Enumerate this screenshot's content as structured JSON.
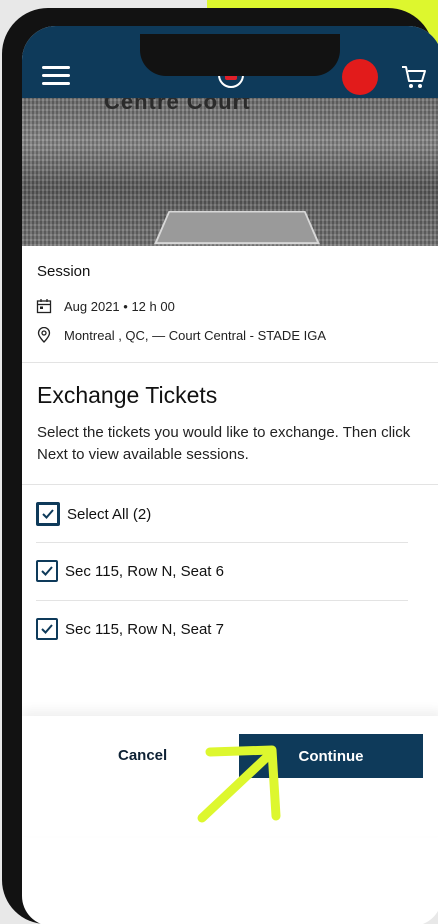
{
  "colors": {
    "accent": "#0e3a5a",
    "highlight": "#ddf72e",
    "avatar": "#e21b1b"
  },
  "header": {
    "menu_icon": "hamburger-menu-icon",
    "logo_icon": "brand-logo-icon",
    "cart_icon": "cart-icon"
  },
  "hero": {
    "sign_text": "Centre Court"
  },
  "session": {
    "title": "Session",
    "date": "Aug 2021 • 12 h 00",
    "location": "Montreal , QC, — Court Central - STADE IGA"
  },
  "exchange": {
    "title": "Exchange Tickets",
    "description": "Select the tickets you would like to exchange. Then click Next to view available sessions."
  },
  "tickets": {
    "select_all": "Select All (2)",
    "items": [
      "Sec 115, Row N, Seat 6",
      "Sec 115, Row N, Seat 7"
    ]
  },
  "footer": {
    "cancel_label": "Cancel",
    "continue_label": "Continue"
  }
}
